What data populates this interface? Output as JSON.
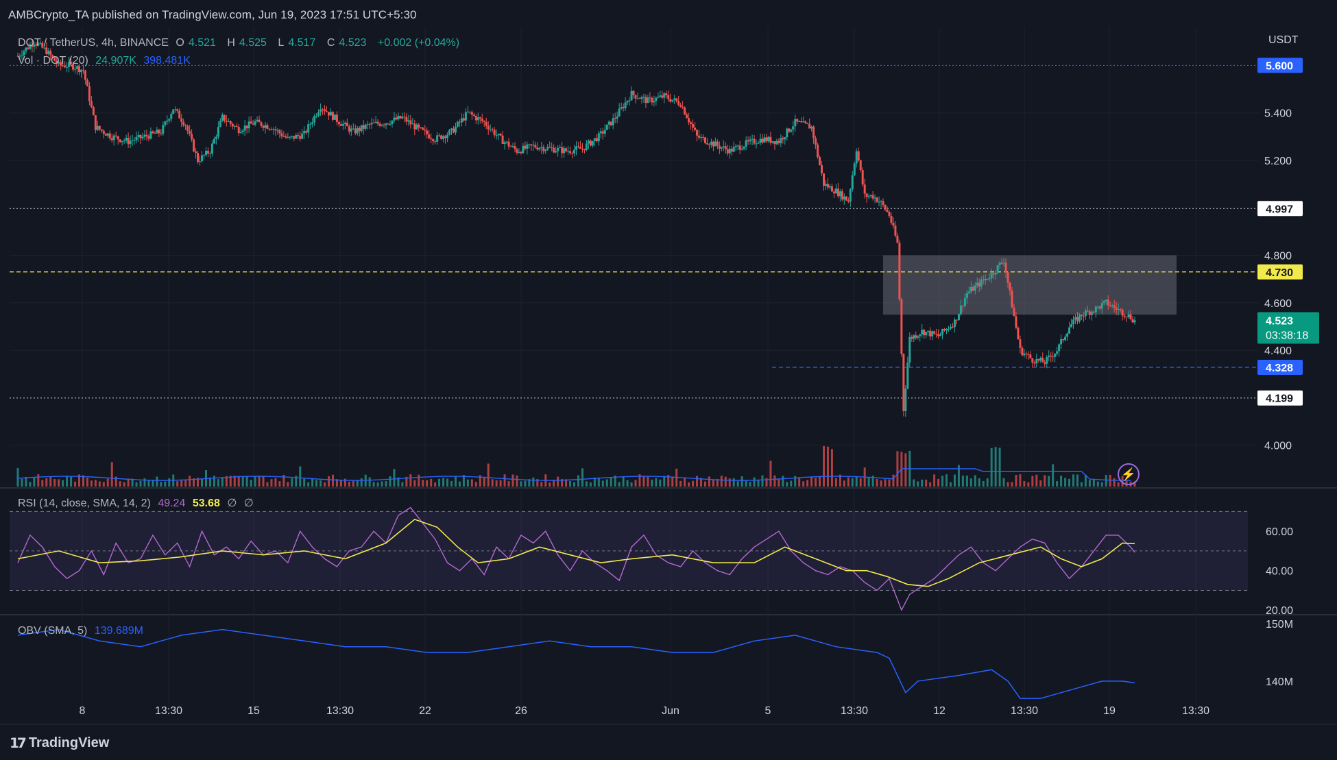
{
  "header": {
    "published_line": "AMBCrypto_TA published on TradingView.com, Jun 19, 2023 17:51 UTC+5:30"
  },
  "legend": {
    "symbol": "DOT / TetherUS, 4h, BINANCE",
    "o_label": "O",
    "o_value": "4.521",
    "h_label": "H",
    "h_value": "4.525",
    "l_label": "L",
    "l_value": "4.517",
    "c_label": "C",
    "c_value": "4.523",
    "change": "+0.002 (+0.04%)",
    "vol_label": "Vol · DOT (20)",
    "vol_value": "24.907K",
    "vol_ma": "398.481K",
    "rsi_label": "RSI (14, close, SMA, 14, 2)",
    "rsi_value": "49.24",
    "rsi_sma": "53.68",
    "rsi_extra1": "∅",
    "rsi_extra2": "∅",
    "obv_label": "OBV (SMA, 5)",
    "obv_value": "139.689M"
  },
  "price_axis": {
    "unit": "USDT",
    "ticks": [
      "5.400",
      "5.200",
      "4.800",
      "4.600",
      "4.400",
      "4.000"
    ],
    "tick_values": [
      5.4,
      5.2,
      4.8,
      4.6,
      4.4,
      4.0
    ],
    "marker_labels": [
      {
        "text": "5.600",
        "value": 5.6,
        "bg": "#2962ff",
        "fg": "#ffffff"
      },
      {
        "text": "4.997",
        "value": 4.997,
        "bg": "#ffffff",
        "fg": "#131722"
      },
      {
        "text": "4.730",
        "value": 4.73,
        "bg": "#f2ea4c",
        "fg": "#131722"
      },
      {
        "text": "4.328",
        "value": 4.328,
        "bg": "#2962ff",
        "fg": "#ffffff"
      },
      {
        "text": "4.199",
        "value": 4.199,
        "bg": "#ffffff",
        "fg": "#131722"
      }
    ],
    "current_price": "4.523",
    "countdown": "03:38:18",
    "current_bg": "#089981"
  },
  "rsi_axis": {
    "ticks": [
      "60.00",
      "40.00",
      "20.00"
    ],
    "tick_values": [
      60,
      40,
      20
    ]
  },
  "obv_axis": {
    "ticks": [
      "150M",
      "140M"
    ],
    "tick_values": [
      150,
      140
    ]
  },
  "time_axis": {
    "labels": [
      "8",
      "13:30",
      "15",
      "13:30",
      "22",
      "26",
      "Jun",
      "5",
      "13:30",
      "12",
      "13:30",
      "19",
      "13:30"
    ]
  },
  "colors": {
    "up": "#26a69a",
    "down": "#ef5350",
    "rsi_line": "#b36ad0",
    "rsi_sma": "#f2ea4c",
    "obv_line": "#2962ff",
    "vol_ma": "#2962ff",
    "background": "#131722",
    "zone_fill": "#787b86"
  },
  "branding": {
    "logo_text": "TradingView",
    "logo_icon": "tradingview-logo-icon",
    "bolt_icon": "lightning-bolt-icon"
  },
  "chart_data": {
    "type": "candlestick",
    "title": "DOT / TetherUS, 4h, BINANCE",
    "ylabel": "USDT",
    "ylim": [
      3.82,
      5.76
    ],
    "horizontal_levels": [
      {
        "value": 5.6,
        "style": "dotted",
        "color": "#2962ff"
      },
      {
        "value": 4.997,
        "style": "dotted",
        "color": "#b2b5be"
      },
      {
        "value": 4.73,
        "style": "dashed",
        "color": "#f2ea4c"
      },
      {
        "value": 4.328,
        "style": "dashed",
        "color": "#2962ff"
      },
      {
        "value": 4.199,
        "style": "dotted",
        "color": "#b2b5be"
      }
    ],
    "zone": {
      "y_low": 4.55,
      "y_high": 4.8,
      "from_date": "Jun 10",
      "to_date": "Jun 20"
    },
    "close_path": [
      [
        0,
        5.64
      ],
      [
        8,
        5.7
      ],
      [
        14,
        5.66
      ],
      [
        20,
        5.6
      ],
      [
        26,
        5.6
      ],
      [
        32,
        5.58
      ],
      [
        38,
        5.34
      ],
      [
        46,
        5.3
      ],
      [
        54,
        5.28
      ],
      [
        62,
        5.3
      ],
      [
        70,
        5.32
      ],
      [
        76,
        5.42
      ],
      [
        82,
        5.35
      ],
      [
        88,
        5.2
      ],
      [
        94,
        5.24
      ],
      [
        100,
        5.38
      ],
      [
        108,
        5.33
      ],
      [
        116,
        5.36
      ],
      [
        124,
        5.34
      ],
      [
        132,
        5.29
      ],
      [
        140,
        5.31
      ],
      [
        148,
        5.43
      ],
      [
        156,
        5.37
      ],
      [
        164,
        5.32
      ],
      [
        172,
        5.35
      ],
      [
        180,
        5.36
      ],
      [
        188,
        5.38
      ],
      [
        196,
        5.33
      ],
      [
        204,
        5.29
      ],
      [
        212,
        5.32
      ],
      [
        220,
        5.4
      ],
      [
        228,
        5.36
      ],
      [
        236,
        5.29
      ],
      [
        244,
        5.24
      ],
      [
        252,
        5.26
      ],
      [
        260,
        5.25
      ],
      [
        268,
        5.24
      ],
      [
        276,
        5.25
      ],
      [
        284,
        5.3
      ],
      [
        292,
        5.38
      ],
      [
        300,
        5.48
      ],
      [
        308,
        5.45
      ],
      [
        316,
        5.47
      ],
      [
        324,
        5.44
      ],
      [
        332,
        5.3
      ],
      [
        340,
        5.27
      ],
      [
        348,
        5.24
      ],
      [
        356,
        5.27
      ],
      [
        364,
        5.29
      ],
      [
        372,
        5.28
      ],
      [
        380,
        5.36
      ],
      [
        388,
        5.34
      ],
      [
        394,
        5.1
      ],
      [
        400,
        5.07
      ],
      [
        406,
        5.03
      ],
      [
        410,
        5.25
      ],
      [
        414,
        5.05
      ],
      [
        418,
        5.05
      ],
      [
        422,
        5.02
      ],
      [
        426,
        4.97
      ],
      [
        430,
        4.85
      ],
      [
        433,
        4.15
      ],
      [
        436,
        4.45
      ],
      [
        442,
        4.48
      ],
      [
        450,
        4.46
      ],
      [
        458,
        4.52
      ],
      [
        464,
        4.64
      ],
      [
        470,
        4.68
      ],
      [
        476,
        4.72
      ],
      [
        482,
        4.78
      ],
      [
        486,
        4.59
      ],
      [
        490,
        4.4
      ],
      [
        496,
        4.36
      ],
      [
        502,
        4.35
      ],
      [
        508,
        4.4
      ],
      [
        514,
        4.5
      ],
      [
        520,
        4.55
      ],
      [
        526,
        4.57
      ],
      [
        532,
        4.6
      ],
      [
        538,
        4.57
      ],
      [
        544,
        4.54
      ],
      [
        546,
        4.523
      ]
    ],
    "rsi_path": [
      [
        0,
        44
      ],
      [
        6,
        58
      ],
      [
        12,
        52
      ],
      [
        18,
        42
      ],
      [
        24,
        36
      ],
      [
        30,
        40
      ],
      [
        36,
        50
      ],
      [
        42,
        38
      ],
      [
        48,
        54
      ],
      [
        54,
        44
      ],
      [
        60,
        46
      ],
      [
        66,
        58
      ],
      [
        72,
        48
      ],
      [
        78,
        54
      ],
      [
        84,
        42
      ],
      [
        90,
        60
      ],
      [
        96,
        48
      ],
      [
        102,
        52
      ],
      [
        108,
        46
      ],
      [
        114,
        55
      ],
      [
        120,
        48
      ],
      [
        126,
        50
      ],
      [
        132,
        44
      ],
      [
        138,
        60
      ],
      [
        144,
        52
      ],
      [
        150,
        46
      ],
      [
        156,
        42
      ],
      [
        162,
        50
      ],
      [
        168,
        52
      ],
      [
        174,
        60
      ],
      [
        180,
        54
      ],
      [
        186,
        68
      ],
      [
        192,
        72
      ],
      [
        198,
        64
      ],
      [
        204,
        56
      ],
      [
        210,
        44
      ],
      [
        216,
        40
      ],
      [
        222,
        46
      ],
      [
        228,
        38
      ],
      [
        234,
        52
      ],
      [
        240,
        46
      ],
      [
        246,
        58
      ],
      [
        252,
        54
      ],
      [
        258,
        60
      ],
      [
        264,
        48
      ],
      [
        270,
        40
      ],
      [
        276,
        50
      ],
      [
        282,
        44
      ],
      [
        288,
        40
      ],
      [
        294,
        35
      ],
      [
        300,
        52
      ],
      [
        306,
        58
      ],
      [
        312,
        48
      ],
      [
        318,
        44
      ],
      [
        324,
        42
      ],
      [
        330,
        50
      ],
      [
        336,
        44
      ],
      [
        342,
        40
      ],
      [
        348,
        38
      ],
      [
        354,
        46
      ],
      [
        360,
        52
      ],
      [
        366,
        56
      ],
      [
        372,
        60
      ],
      [
        378,
        50
      ],
      [
        384,
        44
      ],
      [
        390,
        40
      ],
      [
        396,
        38
      ],
      [
        402,
        42
      ],
      [
        408,
        40
      ],
      [
        414,
        34
      ],
      [
        420,
        30
      ],
      [
        426,
        36
      ],
      [
        432,
        20
      ],
      [
        436,
        28
      ],
      [
        442,
        32
      ],
      [
        448,
        36
      ],
      [
        454,
        42
      ],
      [
        460,
        48
      ],
      [
        466,
        52
      ],
      [
        472,
        44
      ],
      [
        478,
        40
      ],
      [
        484,
        46
      ],
      [
        490,
        52
      ],
      [
        496,
        56
      ],
      [
        502,
        54
      ],
      [
        508,
        44
      ],
      [
        514,
        36
      ],
      [
        520,
        42
      ],
      [
        526,
        50
      ],
      [
        532,
        58
      ],
      [
        538,
        58
      ],
      [
        544,
        52
      ],
      [
        546,
        49.24
      ]
    ],
    "rsi_sma_path": [
      [
        0,
        46
      ],
      [
        20,
        50
      ],
      [
        40,
        44
      ],
      [
        60,
        45
      ],
      [
        80,
        47
      ],
      [
        100,
        50
      ],
      [
        120,
        48
      ],
      [
        140,
        50
      ],
      [
        160,
        46
      ],
      [
        180,
        54
      ],
      [
        194,
        66
      ],
      [
        205,
        62
      ],
      [
        215,
        52
      ],
      [
        225,
        44
      ],
      [
        240,
        46
      ],
      [
        255,
        52
      ],
      [
        270,
        48
      ],
      [
        285,
        44
      ],
      [
        300,
        46
      ],
      [
        320,
        48
      ],
      [
        340,
        44
      ],
      [
        360,
        44
      ],
      [
        375,
        52
      ],
      [
        390,
        46
      ],
      [
        405,
        40
      ],
      [
        415,
        40
      ],
      [
        425,
        37
      ],
      [
        435,
        33
      ],
      [
        445,
        32
      ],
      [
        455,
        36
      ],
      [
        470,
        44
      ],
      [
        485,
        48
      ],
      [
        500,
        52
      ],
      [
        510,
        46
      ],
      [
        520,
        42
      ],
      [
        530,
        46
      ],
      [
        540,
        54
      ],
      [
        546,
        53.68
      ]
    ],
    "obv_path": [
      [
        0,
        148
      ],
      [
        20,
        149
      ],
      [
        40,
        147
      ],
      [
        60,
        146
      ],
      [
        80,
        148
      ],
      [
        100,
        149
      ],
      [
        120,
        148
      ],
      [
        140,
        147
      ],
      [
        160,
        146
      ],
      [
        180,
        146
      ],
      [
        200,
        145
      ],
      [
        220,
        145
      ],
      [
        240,
        146
      ],
      [
        260,
        147
      ],
      [
        280,
        146
      ],
      [
        300,
        146
      ],
      [
        320,
        145
      ],
      [
        340,
        145
      ],
      [
        360,
        147
      ],
      [
        380,
        148
      ],
      [
        400,
        146
      ],
      [
        420,
        145
      ],
      [
        426,
        144
      ],
      [
        434,
        138
      ],
      [
        440,
        140
      ],
      [
        460,
        141
      ],
      [
        476,
        142
      ],
      [
        484,
        140
      ],
      [
        490,
        137
      ],
      [
        500,
        137
      ],
      [
        510,
        138
      ],
      [
        520,
        139
      ],
      [
        530,
        140
      ],
      [
        540,
        140
      ],
      [
        546,
        139.689
      ]
    ],
    "volume_level": "low with spikes at Jun 6 and Jun 10 and Jun 15"
  }
}
